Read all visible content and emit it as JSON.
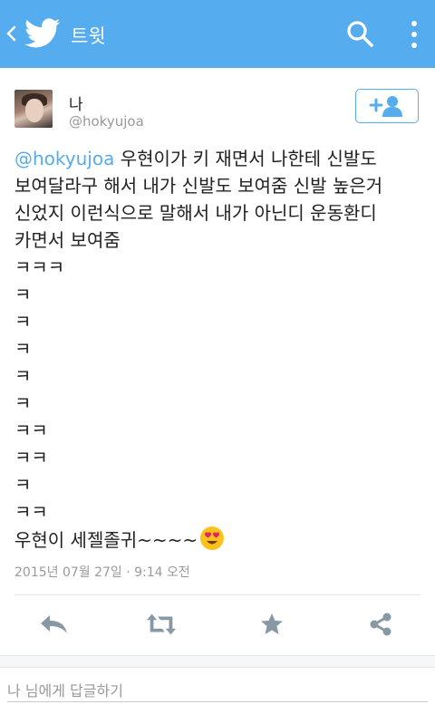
{
  "appbar": {
    "title": "트윗",
    "background": "#55acee",
    "icons": [
      "back-icon",
      "twitter-bird-icon",
      "search-icon",
      "more-vertical-icon"
    ]
  },
  "author": {
    "name": "나",
    "handle": "@hokyujoa",
    "follow_icon": "add-user-icon"
  },
  "tweet": {
    "mention": "@hokyujoa",
    "text": " 우현이가 키 재면서 나한테 신발도 보여달라구 해서 내가 신발도 보여줌 신발 높은거 신었지 이런식으로 말해서 내가 아닌디 운동환디 카면서 보여줌",
    "laugh_lines": [
      "ㅋㅋㅋ",
      "ㅋ",
      "ㅋ",
      "ㅋ",
      "ㅋ",
      "ㅋ",
      "ㅋㅋ",
      "ㅋㅋ",
      "ㅋ",
      "ㅋㅋ"
    ],
    "closing": "우현이 세젤졸귀~~~~",
    "emoji": "heart-eyes-emoji",
    "timestamp": "2015년 07월 27일 · 9:14 오전"
  },
  "actions": [
    "reply-icon",
    "retweet-icon",
    "favorite-icon",
    "share-icon"
  ],
  "reply_box": {
    "placeholder": "나 님에게 답글하기"
  },
  "colors": {
    "accent": "#55acee",
    "action_icon": "#8899a6",
    "muted_text": "#9a9a9a"
  }
}
